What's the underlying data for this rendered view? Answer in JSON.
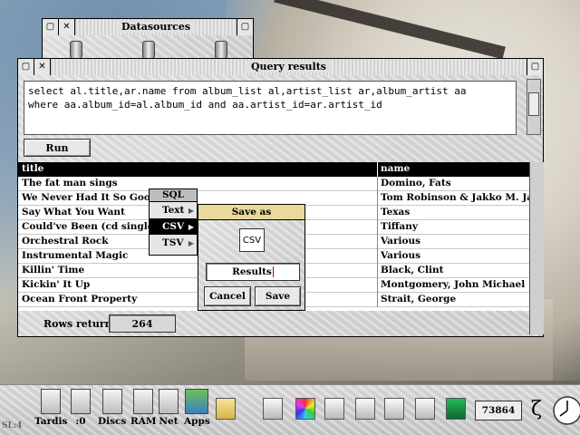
{
  "datasources_window": {
    "title": "Datasources"
  },
  "query_window": {
    "title": "Query results",
    "sql_line1": "select al.title,ar.name from album_list al,artist_list ar,album_artist aa",
    "sql_line2": "where aa.album_id=al.album_id and aa.artist_id=ar.artist_id",
    "run_label": "Run",
    "columns": [
      "title",
      "name"
    ],
    "rows": [
      [
        "The fat man sings",
        "Domino, Fats"
      ],
      [
        "We Never Had It So Good",
        "Tom Robinson & Jakko M. Jakszyk"
      ],
      [
        "Say What You Want",
        "Texas"
      ],
      [
        "Could've Been (cd single)",
        "Tiffany"
      ],
      [
        "Orchestral Rock",
        "Various"
      ],
      [
        "Instrumental Magic",
        "Various"
      ],
      [
        "Killin' Time",
        "Black, Clint"
      ],
      [
        "Kickin' It Up",
        "Montgomery, John Michael"
      ],
      [
        "Ocean Front Property",
        "Strait, George"
      ]
    ],
    "rows_returned_label": "Rows returned",
    "rows_returned_value": "264"
  },
  "menu": {
    "title": "SQL",
    "items": [
      "Text",
      "CSV",
      "TSV"
    ],
    "selected": "CSV"
  },
  "save_dialog": {
    "title": "Save as",
    "file_type_icon": "CSV",
    "filename": "Results",
    "cancel_label": "Cancel",
    "save_label": "Save"
  },
  "iconbar": {
    "left_label": "SL:4",
    "items": [
      "Tardis",
      ":0",
      "Discs",
      "RAM",
      "Net",
      "Apps"
    ],
    "memory_counter": "73864",
    "zeta": "ζ"
  }
}
